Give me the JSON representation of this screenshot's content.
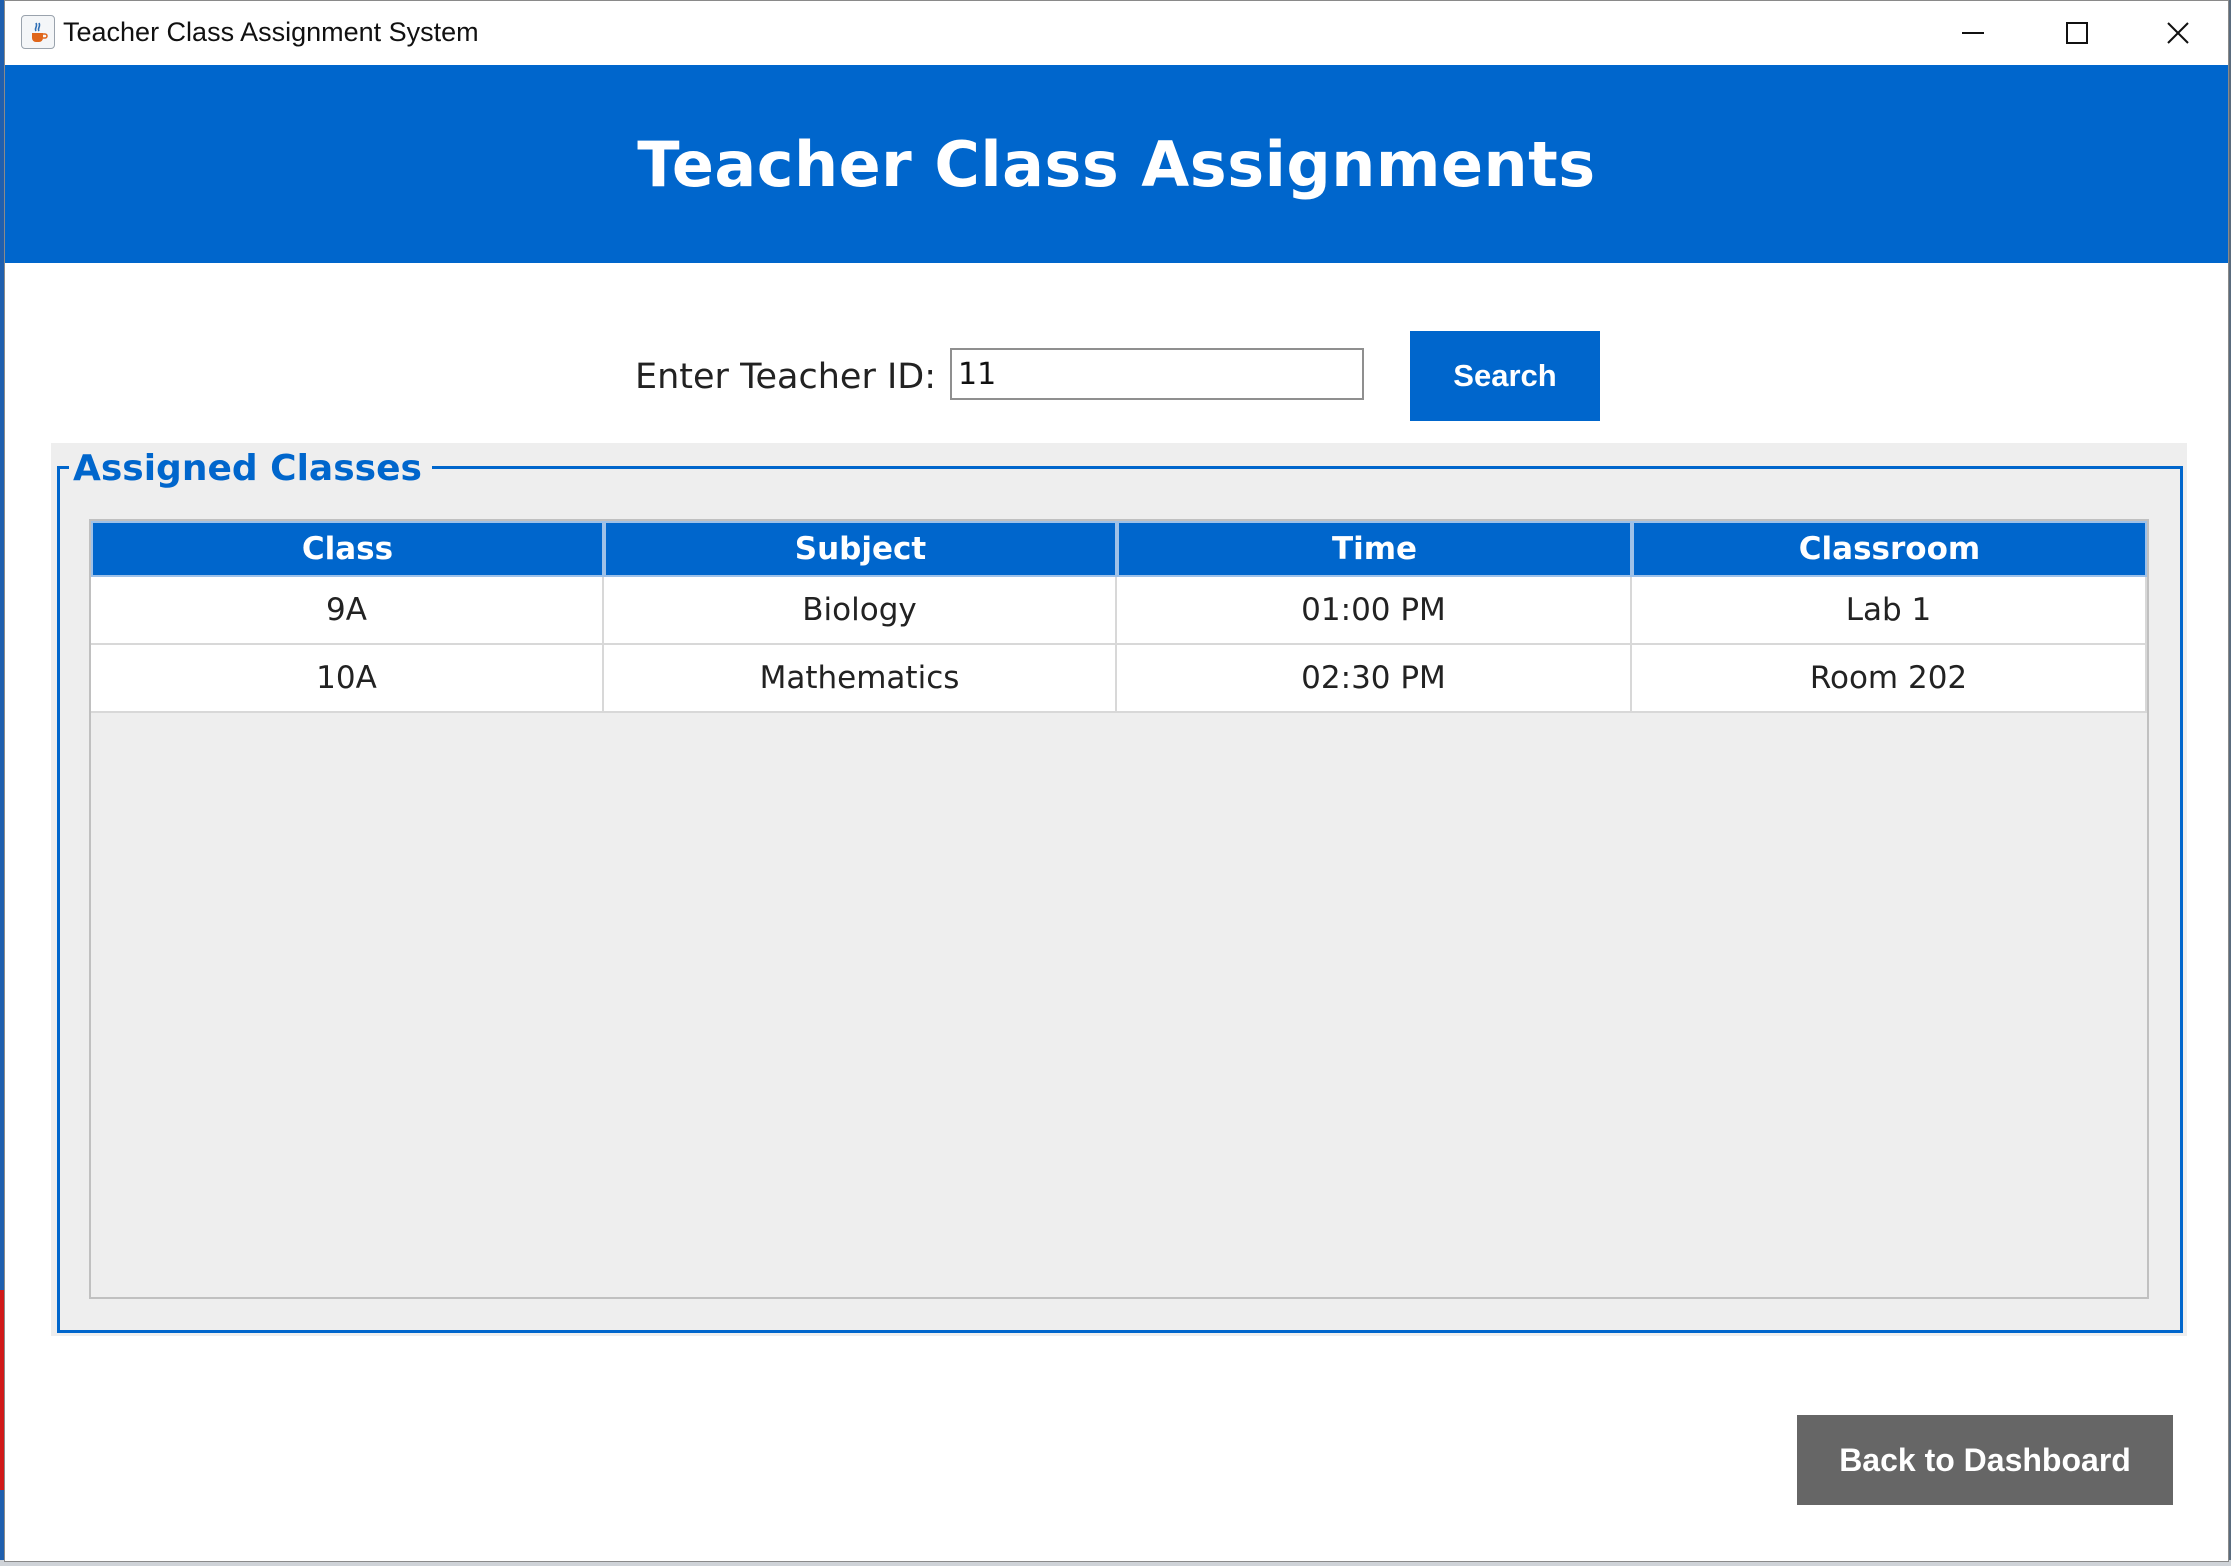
{
  "window": {
    "title": "Teacher Class Assignment System",
    "icon": "java-cup-icon",
    "controls": [
      "minimize-icon",
      "maximize-icon",
      "close-icon"
    ]
  },
  "header": {
    "title": "Teacher Class Assignments"
  },
  "search": {
    "label": "Enter Teacher ID:",
    "value": "11",
    "button_label": "Search"
  },
  "assigned": {
    "legend": "Assigned Classes",
    "columns": [
      "Class",
      "Subject",
      "Time",
      "Classroom"
    ],
    "rows": [
      [
        "9A",
        "Biology",
        "01:00 PM",
        "Lab 1"
      ],
      [
        "10A",
        "Mathematics",
        "02:30 PM",
        "Room 202"
      ]
    ]
  },
  "footer": {
    "back_label": "Back to Dashboard"
  },
  "colors": {
    "accent": "#0066cc",
    "secondary_button": "#666666",
    "panel_background": "#eeeeee"
  }
}
